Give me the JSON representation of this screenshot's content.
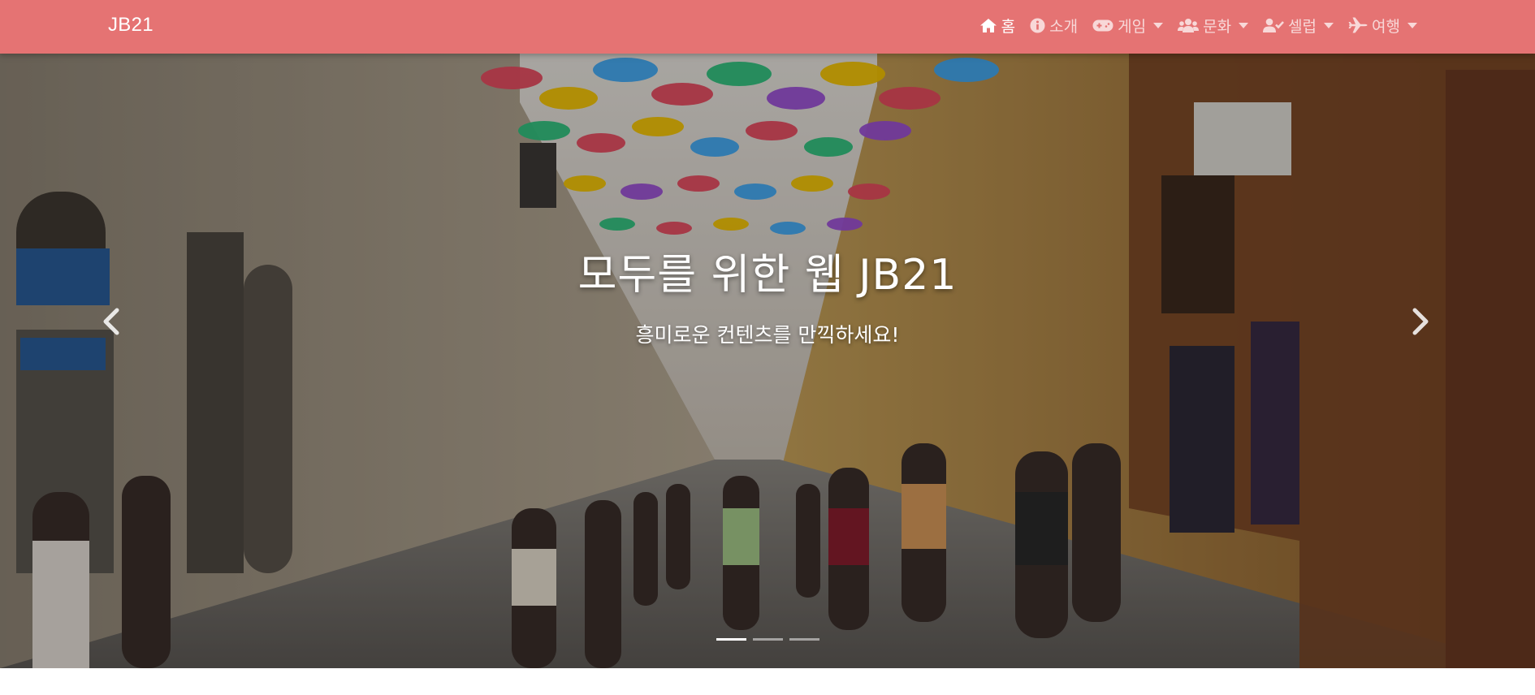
{
  "navbar": {
    "brand": "JB21",
    "background": "#e57373",
    "items": [
      {
        "label": "홈",
        "icon": "home-icon",
        "dropdown": false,
        "active": true
      },
      {
        "label": "소개",
        "icon": "info-circle-icon",
        "dropdown": false,
        "active": false
      },
      {
        "label": "게임",
        "icon": "gamepad-icon",
        "dropdown": true,
        "active": false
      },
      {
        "label": "문화",
        "icon": "users-icon",
        "dropdown": true,
        "active": false
      },
      {
        "label": "셀럽",
        "icon": "user-check-icon",
        "dropdown": true,
        "active": false
      },
      {
        "label": "여행",
        "icon": "plane-icon",
        "dropdown": true,
        "active": false
      }
    ]
  },
  "carousel": {
    "title": "모두를 위한 웹 JB21",
    "subtitle": "흥미로운 컨텐츠를 만끽하세요!",
    "prev_icon": "chevron-left-icon",
    "next_icon": "chevron-right-icon",
    "slide_count": 3,
    "active_slide": 1,
    "image": "street-with-colorful-umbrellas"
  }
}
